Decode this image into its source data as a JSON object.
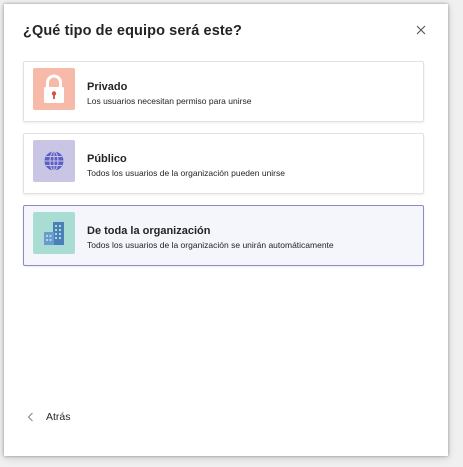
{
  "dialog": {
    "title": "¿Qué tipo de equipo será este?",
    "close_icon": "close-icon"
  },
  "options": [
    {
      "title": "Privado",
      "description": "Los usuarios necesitan permiso para unirse",
      "icon": "lock-icon",
      "icon_bg": "#f7b9a8",
      "icon_color": "#c4412f",
      "selected": false
    },
    {
      "title": "Público",
      "description": "Todos los usuarios de la organización pueden unirse",
      "icon": "globe-icon",
      "icon_bg": "#c9c5e4",
      "icon_color": "#5b5fc7",
      "selected": false
    },
    {
      "title": "De toda la organización",
      "description": "Todos los usuarios de la organización se unirán automáticamente",
      "icon": "building-icon",
      "icon_bg": "#a9dcd3",
      "icon_color": "#4a7fb8",
      "selected": true
    }
  ],
  "footer": {
    "back_label": "Atrás",
    "back_icon": "chevron-left-icon"
  },
  "colors": {
    "selected_border": "#8b8cc7",
    "selected_bg": "#f5f5fc"
  }
}
